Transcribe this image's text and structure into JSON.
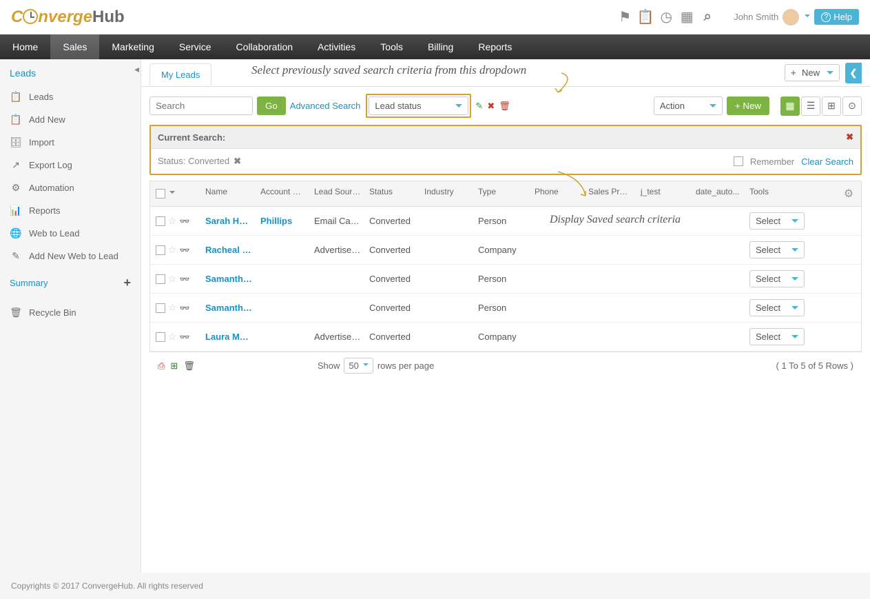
{
  "header": {
    "logo_part1": "C",
    "logo_part2": "nverge",
    "logo_part3": "Hub",
    "user_name": "John Smith",
    "help_label": "Help"
  },
  "nav": {
    "items": [
      "Home",
      "Sales",
      "Marketing",
      "Service",
      "Collaboration",
      "Activities",
      "Tools",
      "Billing",
      "Reports"
    ],
    "active_index": 1
  },
  "sidebar": {
    "title": "Leads",
    "items": [
      {
        "icon": "📋",
        "label": "Leads"
      },
      {
        "icon": "📋",
        "label": "Add New"
      },
      {
        "icon": "🗄",
        "label": "Import"
      },
      {
        "icon": "↗",
        "label": "Export Log"
      },
      {
        "icon": "⚙",
        "label": "Automation"
      },
      {
        "icon": "📊",
        "label": "Reports"
      },
      {
        "icon": "🌐",
        "label": "Web to Lead"
      },
      {
        "icon": "✎",
        "label": "Add New Web to Lead"
      }
    ],
    "summary_label": "Summary",
    "recycle_label": "Recycle Bin"
  },
  "tabs": {
    "active": "My Leads",
    "annotation1": "Select previously saved search criteria from this dropdown",
    "new_label": "New"
  },
  "toolbar": {
    "search_placeholder": "Search",
    "go_label": "Go",
    "adv_label": "Advanced Search",
    "saved_search_value": "Lead status",
    "action_label": "Action",
    "new_btn_label": "+ New"
  },
  "search_panel": {
    "title": "Current Search:",
    "chip": "Status: Converted",
    "remember_label": "Remember",
    "clear_label": "Clear Search",
    "annotation2": "Display Saved search criteria"
  },
  "table": {
    "headers": [
      "Name",
      "Account Name",
      "Lead Source",
      "Status",
      "Industry",
      "Type",
      "Phone",
      "Sales Proces",
      "j_test",
      "date_auto...",
      "Tools"
    ],
    "rows": [
      {
        "name": "Sarah Hoff...",
        "account": "Phillips",
        "source": "Email Cam...",
        "status": "Converted",
        "industry": "",
        "type": "Person",
        "phone": "",
        "sp": "",
        "jt": "",
        "da": ""
      },
      {
        "name": "Racheal B...",
        "account": "",
        "source": "Advertisem...",
        "status": "Converted",
        "industry": "",
        "type": "Company",
        "phone": "",
        "sp": "",
        "jt": "",
        "da": ""
      },
      {
        "name": "Samantha ...",
        "account": "",
        "source": "",
        "status": "Converted",
        "industry": "",
        "type": "Person",
        "phone": "",
        "sp": "",
        "jt": "",
        "da": ""
      },
      {
        "name": "Samantha ...",
        "account": "",
        "source": "",
        "status": "Converted",
        "industry": "",
        "type": "Person",
        "phone": "",
        "sp": "",
        "jt": "",
        "da": ""
      },
      {
        "name": "Laura Mor...",
        "account": "",
        "source": "Advertisem...",
        "status": "Converted",
        "industry": "",
        "type": "Company",
        "phone": "",
        "sp": "",
        "jt": "",
        "da": ""
      }
    ],
    "select_label": "Select"
  },
  "pager": {
    "show_label": "Show",
    "page_size": "50",
    "rows_label": "rows per page",
    "info": "( 1 To 5 of 5 Rows )"
  },
  "footer": {
    "copyright": "Copyrights © 2017 ConvergeHub. All rights reserved"
  }
}
